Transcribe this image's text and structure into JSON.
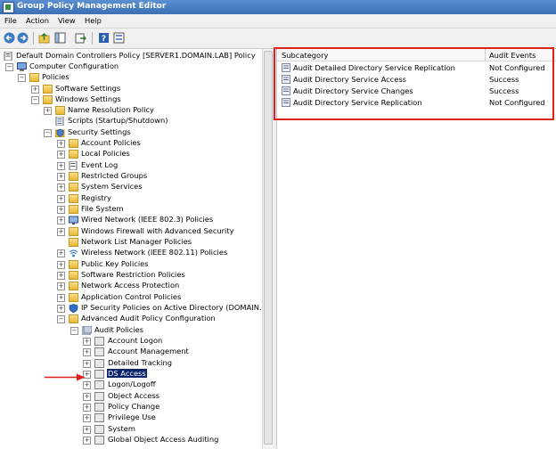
{
  "window": {
    "title": "Group Policy Management Editor"
  },
  "menu": [
    "File",
    "Action",
    "View",
    "Help"
  ],
  "toolbar": {
    "icons": [
      "back-icon",
      "forward-icon",
      "up-folder-icon",
      "show-tree-icon",
      "export-icon",
      "help-icon",
      "properties-icon"
    ]
  },
  "tree": {
    "root": "Default Domain Controllers Policy [SERVER1.DOMAIN.LAB] Policy",
    "computer_config": "Computer Configuration",
    "policies": "Policies",
    "software_settings": "Software Settings",
    "windows_settings": "Windows Settings",
    "name_resolution": "Name Resolution Policy",
    "scripts": "Scripts (Startup/Shutdown)",
    "security_settings": "Security Settings",
    "account_policies": "Account Policies",
    "local_policies": "Local Policies",
    "event_log": "Event Log",
    "restricted_groups": "Restricted Groups",
    "system_services": "System Services",
    "registry": "Registry",
    "file_system": "File System",
    "wired_network": "Wired Network (IEEE 802.3) Policies",
    "windows_firewall": "Windows Firewall with Advanced Security",
    "network_list": "Network List Manager Policies",
    "wireless_network": "Wireless Network (IEEE 802.11) Policies",
    "public_key": "Public Key Policies",
    "software_restriction": "Software Restriction Policies",
    "network_access_protection": "Network Access Protection",
    "application_control": "Application Control Policies",
    "ip_security": "IP Security Policies on Active Directory (DOMAIN.LAB)",
    "advanced_audit": "Advanced Audit Policy Configuration",
    "audit_policies": "Audit Policies",
    "account_logon": "Account Logon",
    "account_management": "Account Management",
    "detailed_tracking": "Detailed Tracking",
    "ds_access": "DS Access",
    "logon_logoff": "Logon/Logoff",
    "object_access": "Object Access",
    "policy_change": "Policy Change",
    "privilege_use": "Privilege Use",
    "system": "System",
    "global_object_access": "Global Object Access Auditing"
  },
  "details": {
    "columns": {
      "subcategory": "Subcategory",
      "audit_events": "Audit Events"
    },
    "rows": [
      {
        "subcategory": "Audit Detailed Directory Service Replication",
        "audit_events": "Not Configured"
      },
      {
        "subcategory": "Audit Directory Service Access",
        "audit_events": "Success"
      },
      {
        "subcategory": "Audit Directory Service Changes",
        "audit_events": "Success"
      },
      {
        "subcategory": "Audit Directory Service Replication",
        "audit_events": "Not Configured"
      }
    ]
  },
  "colors": {
    "annotation_red": "#e0211a",
    "selection": "#0a246a"
  }
}
